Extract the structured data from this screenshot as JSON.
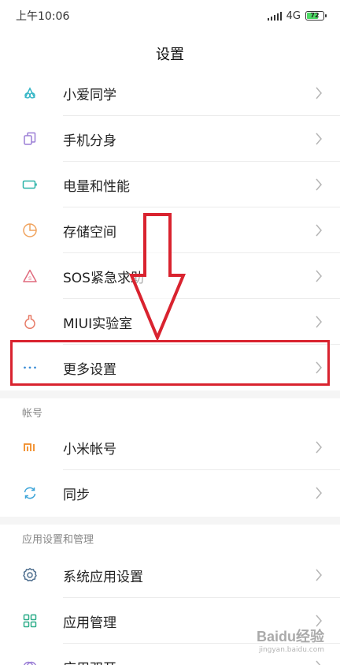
{
  "status_bar": {
    "time": "上午10:06",
    "network": "4G",
    "battery_level": "72",
    "battery_fraction": 0.72
  },
  "header": {
    "title": "设置"
  },
  "section_main": {
    "items": [
      {
        "label": "小爱同学",
        "icon": "xiaoai-icon",
        "color": "#35b6c6"
      },
      {
        "label": "手机分身",
        "icon": "phone-clone-icon",
        "color": "#9b7fd6"
      },
      {
        "label": "电量和性能",
        "icon": "battery-icon",
        "color": "#2bb3a8"
      },
      {
        "label": "存储空间",
        "icon": "storage-pie-icon",
        "color": "#f0a35e"
      },
      {
        "label": "SOS紧急求助",
        "icon": "sos-icon",
        "color": "#e06a7d"
      },
      {
        "label": "MIUI实验室",
        "icon": "lab-flask-icon",
        "color": "#e77a66"
      },
      {
        "label": "更多设置",
        "icon": "more-dots-icon",
        "color": "#3e8fd6"
      }
    ]
  },
  "section_account": {
    "header": "帐号",
    "items": [
      {
        "label": "小米帐号",
        "icon": "mi-logo-icon",
        "color": "#f08a24"
      },
      {
        "label": "同步",
        "icon": "sync-icon",
        "color": "#3aa3d8"
      }
    ]
  },
  "section_apps": {
    "header": "应用设置和管理",
    "items": [
      {
        "label": "系统应用设置",
        "icon": "gear-icon",
        "color": "#4f6f8f"
      },
      {
        "label": "应用管理",
        "icon": "app-grid-icon",
        "color": "#2fae8a"
      },
      {
        "label": "应用双开",
        "icon": "dual-app-icon",
        "color": "#9b7fd6"
      }
    ]
  },
  "annotation": {
    "color": "#d9232f"
  },
  "watermark": {
    "main": "Baidu经验",
    "sub": "jingyan.baidu.com"
  }
}
